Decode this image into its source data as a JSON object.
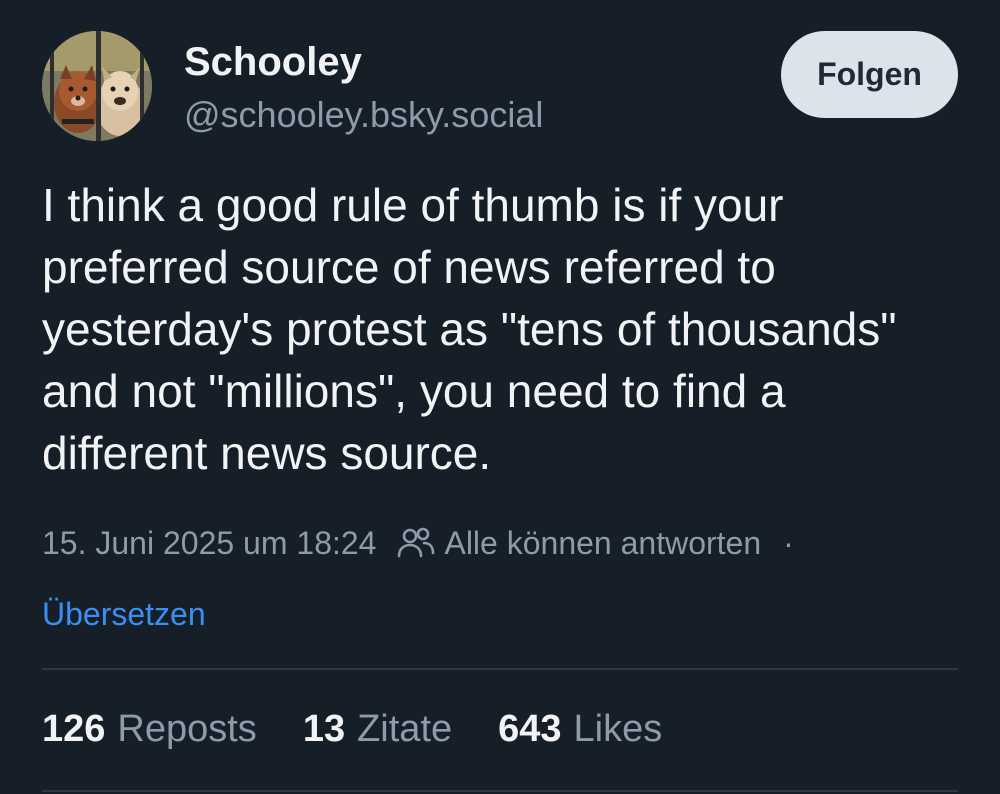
{
  "author": {
    "display_name": "Schooley",
    "handle": "@schooley.bsky.social",
    "avatar_icon": "dogs-behind-fence-avatar"
  },
  "follow_label": "Folgen",
  "post": {
    "text": "I think a good rule of thumb is if your preferred source of news referred to yesterday's protest as \"tens of thousands\" and not \"millions\", you need to find a different news source."
  },
  "meta": {
    "date": "15. Juni 2025 um 18:24",
    "reply_icon": "people-icon",
    "reply_setting": "Alle können antworten",
    "separator": "·"
  },
  "translate_label": "Übersetzen",
  "stats": [
    {
      "count": "126",
      "label": "Reposts"
    },
    {
      "count": "13",
      "label": "Zitate"
    },
    {
      "count": "643",
      "label": "Likes"
    }
  ],
  "colors": {
    "background": "#161e27",
    "link": "#3b8ff0",
    "muted": "#8e9bab",
    "button_bg": "#dde3ea"
  }
}
